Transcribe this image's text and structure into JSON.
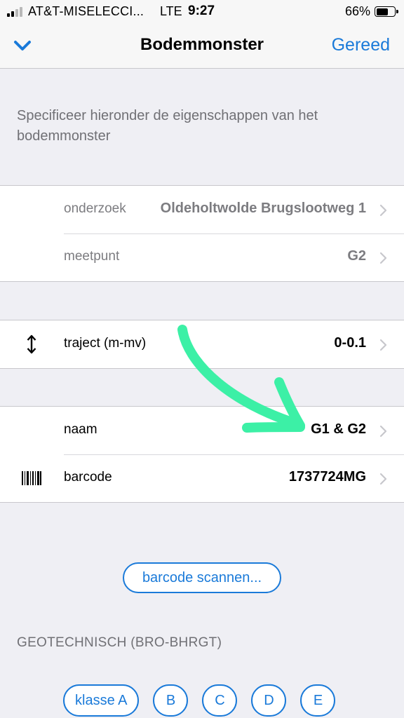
{
  "status_bar": {
    "carrier": "AT&T-MISELECCI...",
    "network": "LTE",
    "time": "9:27",
    "battery": "66%",
    "battery_level": 0.66
  },
  "nav": {
    "back_icon": "chevron-down-icon",
    "title": "Bodemmonster",
    "done_label": "Gereed"
  },
  "description": "Specificeer hieronder de eigenschappen van het bodemmonster",
  "group1": {
    "rows": [
      {
        "label": "onderzoek",
        "value": "Oldeholtwolde Brugslootweg 1"
      },
      {
        "label": "meetpunt",
        "value": "G2"
      }
    ]
  },
  "group2": {
    "rows": [
      {
        "icon": "vertical-arrow-icon",
        "label": "traject (m-mv)",
        "value": "0-0.1"
      }
    ]
  },
  "group3": {
    "rows": [
      {
        "label": "naam",
        "value": "G1 & G2"
      },
      {
        "icon": "barcode-icon",
        "label": "barcode",
        "value": "1737724MG"
      }
    ]
  },
  "scan_button": "barcode scannen...",
  "section_header": "GEOTECHNISCH (BRO-BHRGT)",
  "klasse_buttons": [
    "klasse A",
    "B",
    "C",
    "D",
    "E"
  ],
  "colors": {
    "accent": "#1a7ad9",
    "annotation_arrow": "#3cf0a6",
    "background": "#efeff4"
  }
}
